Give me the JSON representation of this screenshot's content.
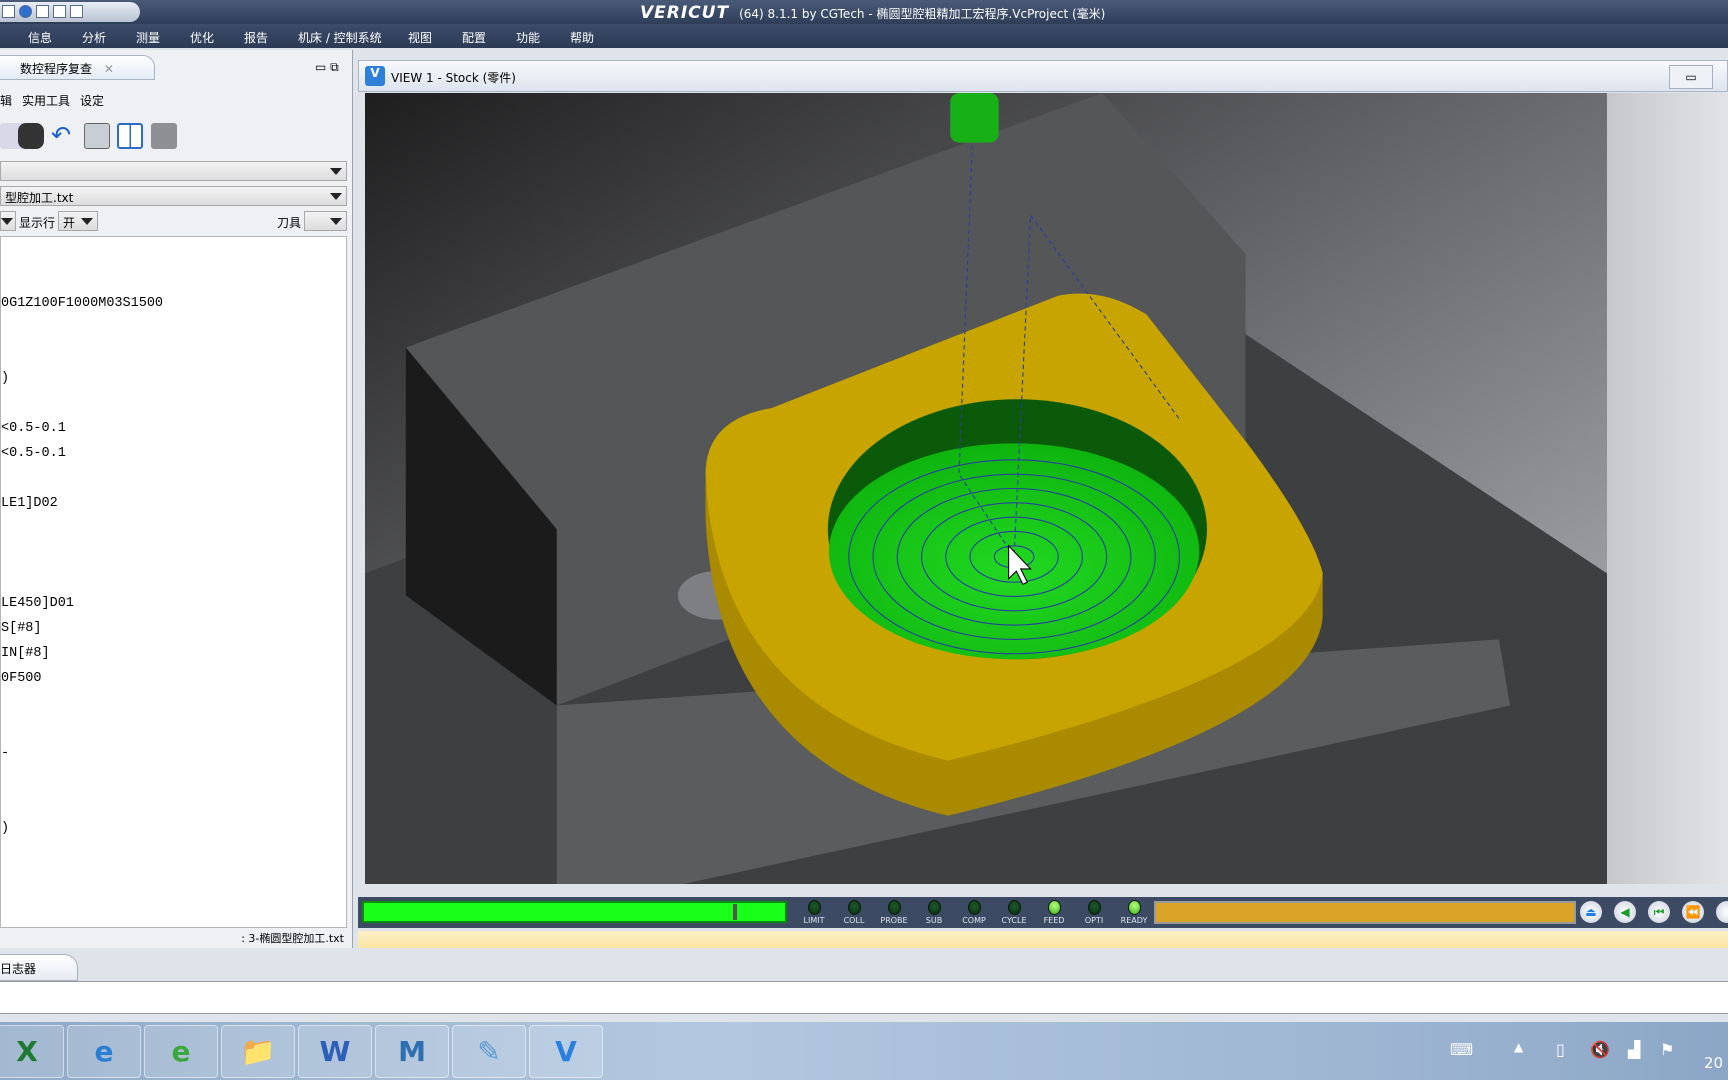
{
  "titlebar": {
    "logo": "VERICUT",
    "title": "(64)  8.1.1 by CGTech - 椭圆型腔粗精加工宏程序.VcProject (毫米)"
  },
  "menu": [
    "信息",
    "分析",
    "测量",
    "优化",
    "报告",
    "机床 / 控制系统",
    "视图",
    "配置",
    "功能",
    "帮助"
  ],
  "left_panel": {
    "tab_label": "数控程序复查",
    "menu": [
      "辑",
      "实用工具",
      "设定"
    ],
    "dropdown1": "",
    "dropdown2": "型腔加工.txt",
    "row_label": "显示行",
    "row_value": "开",
    "tool_label": "刀具",
    "code_lines": [
      "",
      "",
      "0G1Z100F1000M03S1500",
      "",
      "",
      ")",
      "",
      "<0.5-0.1",
      "<0.5-0.1",
      "",
      "LE1]D02",
      "",
      "",
      "",
      "LE450]D01",
      "S[#8]",
      "IN[#8]",
      "0F500",
      "",
      "",
      "-",
      "",
      "",
      ")",
      "",
      "",
      ""
    ],
    "status": ": 3-椭圆型腔加工.txt"
  },
  "view": {
    "title": "VIEW 1 - Stock (零件)"
  },
  "sim": {
    "progress": 0.89,
    "leds": [
      {
        "label": "LIMIT",
        "on": false
      },
      {
        "label": "COLL",
        "on": false
      },
      {
        "label": "PROBE",
        "on": false
      },
      {
        "label": "SUB",
        "on": false
      },
      {
        "label": "COMP",
        "on": false
      },
      {
        "label": "CYCLE",
        "on": false
      },
      {
        "label": "FEED",
        "on": true
      },
      {
        "label": "OPTI",
        "on": false
      },
      {
        "label": "READY",
        "on": true
      }
    ],
    "nav_icons": [
      "eject-icon",
      "step-back-icon",
      "rewind-to-start-icon",
      "fast-rewind-icon"
    ]
  },
  "log": {
    "tab_label": "日志器"
  },
  "taskbar": {
    "apps": [
      "X",
      "e",
      "e",
      "📁",
      "W",
      "M",
      "✎",
      "V"
    ],
    "clock_partial": "20"
  },
  "colors": {
    "stock": "#c8a400",
    "cut": "#19c319",
    "fixture": "#4a4b4d",
    "tool": "#17b017"
  }
}
